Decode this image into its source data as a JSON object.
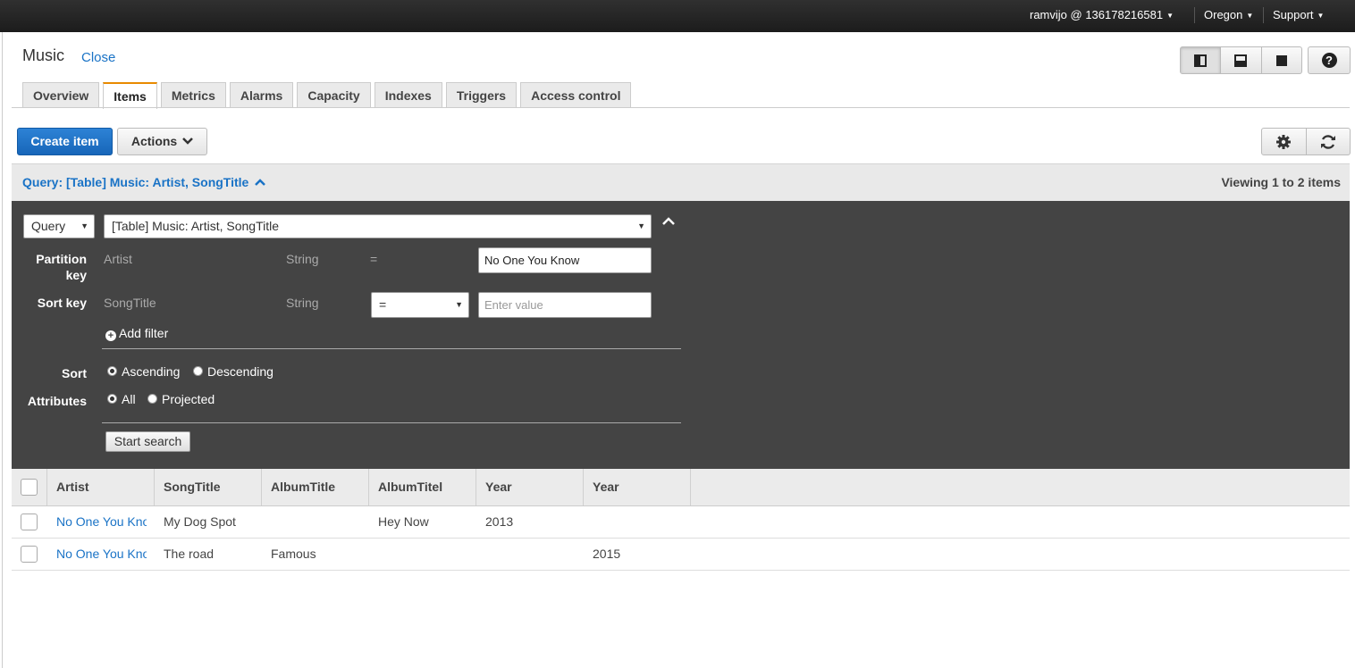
{
  "topbar": {
    "account": "ramvijo @ 136178216581",
    "region": "Oregon",
    "support": "Support"
  },
  "page": {
    "title": "Music",
    "close_label": "Close"
  },
  "tabs": [
    {
      "label": "Overview"
    },
    {
      "label": "Items"
    },
    {
      "label": "Metrics"
    },
    {
      "label": "Alarms"
    },
    {
      "label": "Capacity"
    },
    {
      "label": "Indexes"
    },
    {
      "label": "Triggers"
    },
    {
      "label": "Access control"
    }
  ],
  "active_tab": "Items",
  "toolbar": {
    "create_label": "Create item",
    "actions_label": "Actions"
  },
  "query_header": {
    "link": "Query: [Table] Music: Artist, SongTitle",
    "viewing": "Viewing 1 to 2 items"
  },
  "query_panel": {
    "mode": "Query",
    "index": "[Table] Music: Artist, SongTitle",
    "partition_label": "Partition key",
    "partition_name": "Artist",
    "partition_type": "String",
    "partition_op": "=",
    "partition_value": "No One You Know",
    "sort_label": "Sort key",
    "sort_name": "SongTitle",
    "sort_type": "String",
    "sort_op": "=",
    "sort_placeholder": "Enter value",
    "add_filter": "Add filter",
    "order_label": "Sort",
    "ascending": "Ascending",
    "descending": "Descending",
    "attributes_label": "Attributes",
    "all": "All",
    "projected": "Projected",
    "start_search": "Start search"
  },
  "table": {
    "columns": [
      "Artist",
      "SongTitle",
      "AlbumTitle",
      "AlbumTitel",
      "Year",
      "Year"
    ],
    "rows": [
      {
        "artist": "No One You Know",
        "song": "My Dog Spot",
        "album_title": "",
        "album_titel": "Hey Now",
        "year1": "2013",
        "year2": ""
      },
      {
        "artist": "No One You Know",
        "song": "The road",
        "album_title": "Famous",
        "album_titel": "",
        "year1": "",
        "year2": "2015"
      }
    ]
  },
  "colors": {
    "primary": "#1766b9",
    "link": "#1a73c6",
    "active_tab_accent": "#e88a00",
    "panel_bg": "#444444"
  }
}
